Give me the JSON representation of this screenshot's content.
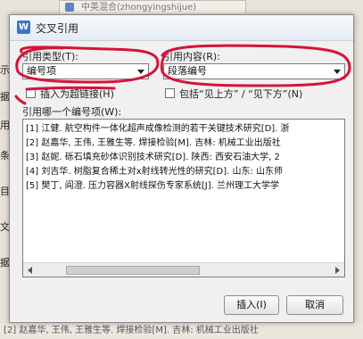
{
  "background": {
    "tab_text": "中英混合(zhongyingshijue)",
    "left_fragments": [
      "示",
      "据",
      "用",
      "条",
      "目",
      "文",
      "据"
    ],
    "bottom_text": "[2] 赵嘉华, 王伟, 王雅生等. 焊接检验[M]. 吉林: 机械工业出版社"
  },
  "dialog": {
    "title": "交叉引用",
    "app_icon": "W",
    "ref_type_label": "引用类型(T):",
    "ref_type_value": "编号项",
    "ref_content_label": "引用内容(R):",
    "ref_content_value": "段落编号",
    "insert_hyperlink_label": "插入为超链接(H)",
    "include_above_below_label": "包括“见上方” / “见下方”(N)",
    "which_item_label": "引用哪一个编号项(W):",
    "items": [
      "[1] 江健. 航空构件一体化超声成像检测的若干关键技术研究[D]. 浙",
      "[2] 赵嘉华, 王伟, 王雅生等. 焊接检验[M]. 吉林: 机械工业出版社",
      "[3] 赵妮. 砾石填充砂体识别技术研究[D]. 陕西: 西安石油大学, 2",
      "[4] 刘吉华. 树脂复合稀土对x射线转光性的研究[D]. 山东: 山东师",
      "[5] 樊丁, 阎澄. 压力容器X射线探伤专家系统[J]. 兰州理工大学学"
    ],
    "insert_button": "插入(I)",
    "cancel_button": "取消"
  },
  "colors": {
    "annotation": "#d4143a",
    "dialog_bg": "#f0f0f0",
    "app_icon": "#3b78c8"
  }
}
